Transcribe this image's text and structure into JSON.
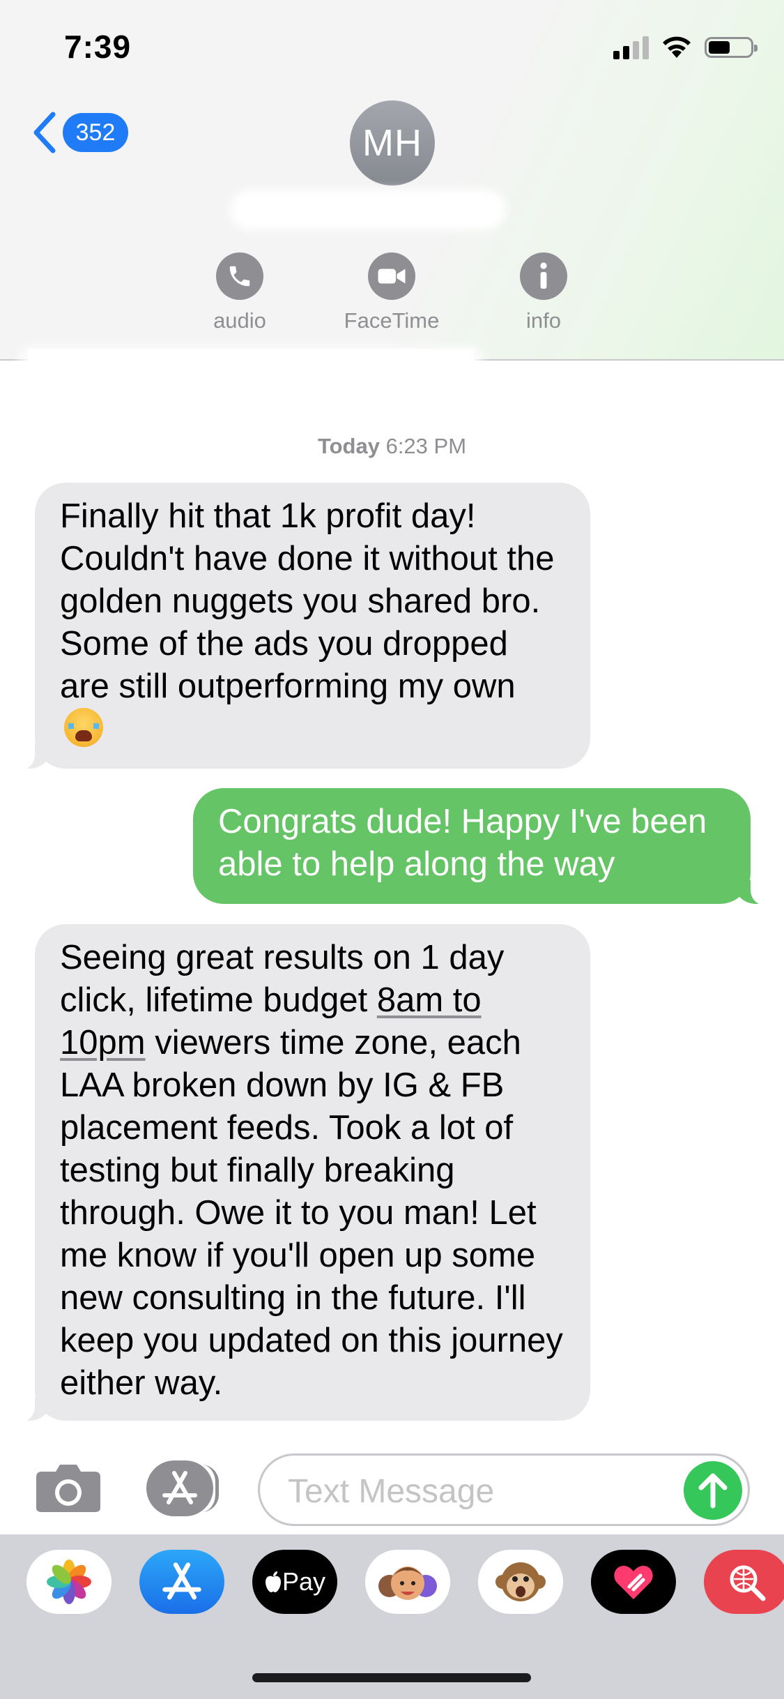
{
  "status_bar": {
    "time": "7:39"
  },
  "header": {
    "back_count": "352",
    "avatar_initials": "MH",
    "actions": [
      {
        "label": "audio",
        "icon": "phone-icon"
      },
      {
        "label": "FaceTime",
        "icon": "video-camera-icon"
      },
      {
        "label": "info",
        "icon": "info-icon"
      }
    ]
  },
  "conversation": {
    "timestamp_day": "Today",
    "timestamp_time": "6:23 PM",
    "messages": [
      {
        "direction": "incoming",
        "text": "Finally hit that 1k profit day! Couldn't have done it without the golden nuggets you shared bro. Some of the ads you dropped are still outperforming my own",
        "emoji": "loudly-crying-face"
      },
      {
        "direction": "outgoing",
        "text": "Congrats dude! Happy I've been able to help along the way"
      },
      {
        "direction": "incoming",
        "text_before_link": "Seeing great results on 1 day click, lifetime budget ",
        "link_text": "8am to 10pm",
        "text_after_link": " viewers time zone, each LAA broken down by IG & FB placement feeds. Took a lot of testing but finally breaking through. Owe it to you man! Let me know if you'll open up some new consulting in the future. I'll keep you updated on this journey either way."
      }
    ]
  },
  "composer": {
    "placeholder": "Text Message"
  },
  "app_drawer": {
    "apps": [
      {
        "name": "photos-app-icon"
      },
      {
        "name": "app-store-icon"
      },
      {
        "name": "apple-pay-icon",
        "label": "Pay"
      },
      {
        "name": "memoji-stickers-icon"
      },
      {
        "name": "animoji-monkey-icon"
      },
      {
        "name": "digital-touch-icon"
      },
      {
        "name": "images-search-icon"
      }
    ]
  },
  "colors": {
    "imessage_blue": "#1f7cf6",
    "sms_green": "#65c466",
    "incoming_gray": "#e9e9eb",
    "send_green": "#35c759"
  }
}
